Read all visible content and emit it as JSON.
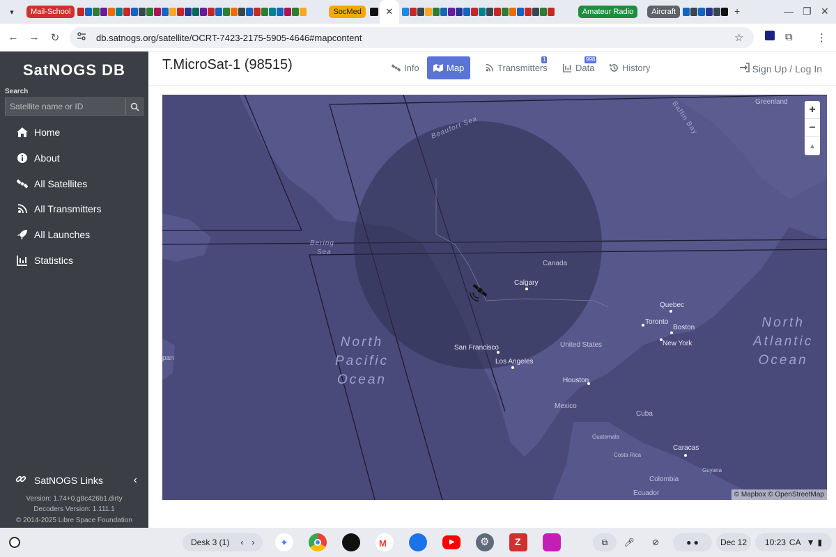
{
  "browser": {
    "tab_groups": [
      {
        "label": "Mail-School",
        "color": "#d0312d"
      },
      {
        "label": "SocMed",
        "color": "#f2a900"
      },
      {
        "label": "Amateur Radio",
        "color": "#1e8e3e"
      },
      {
        "label": "Aircraft",
        "color": "#5f6368"
      }
    ],
    "url": "db.satnogs.org/satellite/OCRT-7423-2175-5905-4646#mapcontent"
  },
  "sidebar": {
    "brand": "SatNOGS DB",
    "search_label": "Search",
    "search_placeholder": "Satellite name or ID",
    "items": [
      {
        "label": "Home",
        "icon": "home-icon"
      },
      {
        "label": "About",
        "icon": "info-icon"
      },
      {
        "label": "All Satellites",
        "icon": "satellite-icon"
      },
      {
        "label": "All Transmitters",
        "icon": "signal-icon"
      },
      {
        "label": "All Launches",
        "icon": "rocket-icon"
      },
      {
        "label": "Statistics",
        "icon": "chart-icon"
      }
    ],
    "links_label": "SatNOGS Links",
    "version": "Version: 1.74+0.g8c426b1.dirty",
    "decoders_version": "Decoders Version: 1.111.1",
    "copyright": "© 2014-2025 Libre Space Foundation"
  },
  "header": {
    "title": "T.MicroSat-1 (98515)",
    "tabs": [
      {
        "label": "Info",
        "active": false
      },
      {
        "label": "Map",
        "active": true
      },
      {
        "label": "Transmitters",
        "active": false,
        "badge": "1"
      },
      {
        "label": "Data",
        "active": false,
        "badge": "998"
      },
      {
        "label": "History",
        "active": false
      }
    ],
    "login": "Sign Up / Log In"
  },
  "map": {
    "labels": {
      "greenland": "Greenland",
      "baffin_bay": "Baffin Bay",
      "beaufort_sea": "Beaufort Sea",
      "bering_sea_1": "Bering",
      "bering_sea_2": "Sea",
      "canada": "Canada",
      "calgary": "Calgary",
      "quebec": "Quebec",
      "toronto": "Toronto",
      "boston": "Boston",
      "new_york": "New York",
      "united_states": "United States",
      "san_francisco": "San Francisco",
      "los_angeles": "Los Angeles",
      "houston": "Houston",
      "mexico": "Mexico",
      "cuba": "Cuba",
      "guatemala": "Guatemala",
      "costa_rica": "Costa Rica",
      "caracas": "Caracas",
      "guyana": "Guyana",
      "colombia": "Colombia",
      "ecuador": "Ecuador",
      "japan_partial": "pan",
      "north_pacific": [
        "North",
        "Pacific",
        "Ocean"
      ],
      "north_atlantic": [
        "North",
        "Atlantic",
        "Ocean"
      ]
    },
    "zoom_in": "+",
    "zoom_out": "−",
    "reset_north": "▲",
    "attribution": "© Mapbox © OpenStreetMap"
  },
  "shelf": {
    "desk_label": "Desk 3 (1)",
    "date": "Dec 12",
    "time": "10:23",
    "region": "CA"
  },
  "colors": {
    "accent": "#5a73d6",
    "sidebar_bg": "#3b3e44",
    "map_bg": "#4a4b7b"
  }
}
